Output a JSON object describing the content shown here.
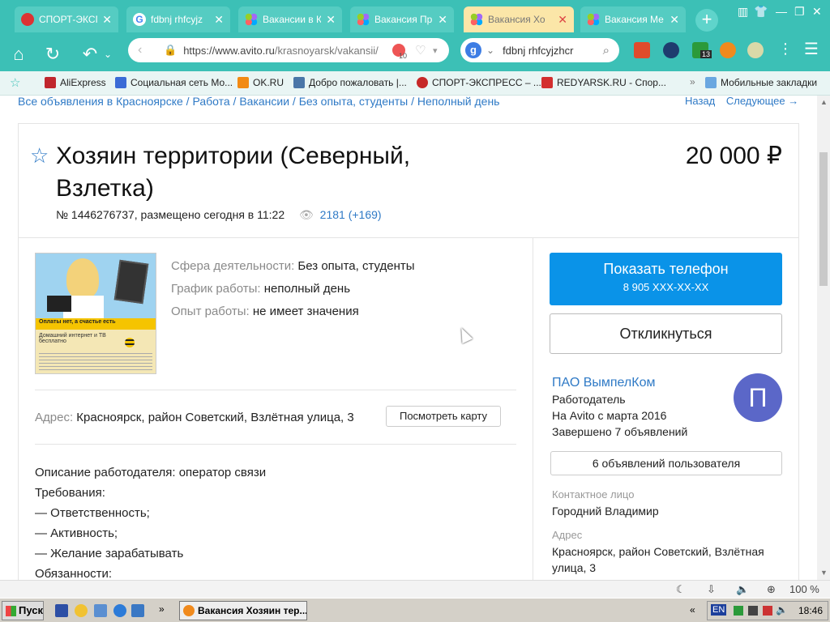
{
  "browser": {
    "tabs": [
      {
        "title": "СПОРТ-ЭКСП",
        "active": false
      },
      {
        "title": "fdbnj rhfcyjz",
        "active": false
      },
      {
        "title": "Вакансии в К",
        "active": false
      },
      {
        "title": "Вакансия Пр",
        "active": false
      },
      {
        "title": "Вакансия Хо",
        "active": true
      },
      {
        "title": "Вакансия Ме",
        "active": false
      }
    ],
    "new_tab": "+",
    "url_domain": "https://www.avito.ru",
    "url_path": "/krasnoyarsk/vakansii/",
    "blocked_count": "10",
    "search_query": "fdbnj rhfcyjzhcr",
    "ext_badge": "13",
    "bookmarks": [
      "AliExpress",
      "Социальная сеть Мо...",
      "OK.RU",
      "Добро пожаловать |...",
      "СПОРТ-ЭКСПРЕСС – ...",
      "REDYARSK.RU - Спор..."
    ],
    "mobile_bookmarks": "Мобильные закладки",
    "bookmarks_more": "»",
    "zoom": "100 %"
  },
  "page": {
    "breadcrumb": "Все объявления в Красноярске / Работа / Вакансии / Без опыта, студенты / Неполный день",
    "nav_back": "Назад",
    "nav_next": "Следующее →",
    "title": "Хозяин территории (Северный, Взлетка)",
    "price": "20 000 ₽",
    "meta_text": "№ 1446276737, размещено сегодня в 11:22",
    "views": "2181 (+169)",
    "params": [
      {
        "label": "Сфера деятельности:",
        "value": "Без опыта, студенты"
      },
      {
        "label": "График работы:",
        "value": "неполный день"
      },
      {
        "label": "Опыт работы:",
        "value": "не имеет значения"
      }
    ],
    "address_label": "Адрес:",
    "address_value": "Красноярск, район Советский, Взлётная улица, 3",
    "map_button": "Посмотреть карту",
    "description": [
      "Описание работодателя: оператор связи",
      "Требования:",
      "— Ответственность;",
      "— Активность;",
      "— Желание зарабатывать",
      "Обязанности:"
    ],
    "photo_caption": "Оплаты нет, а счастье есть",
    "photo_sub": "Домашний интернет и ТВ бесплатно"
  },
  "sidebar": {
    "phone_button": "Показать телефон",
    "phone_number": "8 905 XXX-XX-XX",
    "respond_button": "Откликнуться",
    "seller_name": "ПАО ВымпелКом",
    "seller_role": "Работодатель",
    "seller_since": "На Avito с марта 2016",
    "seller_completed": "Завершено 7 объявлений",
    "avatar_letter": "П",
    "user_ads_button": "6 объявлений пользователя",
    "contact_label": "Контактное лицо",
    "contact_name": "Городний Владимир",
    "address_label": "Адрес",
    "address_value": "Красноярск, район Советский, Взлётная улица, 3"
  },
  "taskbar": {
    "start": "Пуск",
    "task_title": "Вакансия Хозяин тер...",
    "lang": "EN",
    "clock": "18:46"
  },
  "colors": {
    "browser_teal": "#3cc0b6",
    "link_blue": "#2f7ac6",
    "phone_button_blue": "#0a93e8",
    "avatar_purple": "#5b67c8"
  }
}
